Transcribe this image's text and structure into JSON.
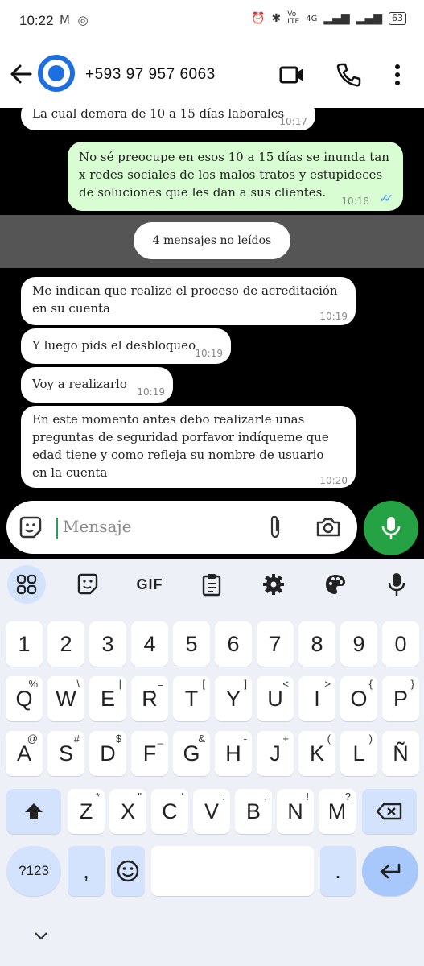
{
  "status_bar": {
    "time": "10:22",
    "battery": "63",
    "network": "4G"
  },
  "header": {
    "contact": "+593 97 957 6063"
  },
  "messages": [
    {
      "direction": "in",
      "text": "La cual demora de 10 a 15 días laborales",
      "time": "10:17"
    },
    {
      "direction": "out",
      "text": "No sé preocupe en esos 10 a 15 días se inunda tan x redes sociales de los malos tratos y estupideces de soluciones que les dan a sus clientes.",
      "time": "10:18",
      "read": true
    },
    {
      "direction": "in",
      "text": "Me indican que realize el proceso de acreditación en su cuenta",
      "time": "10:19"
    },
    {
      "direction": "in",
      "text": "Y luego pids el desbloqueo",
      "time": "10:19"
    },
    {
      "direction": "in",
      "text": "Voy a realizarlo",
      "time": "10:19"
    },
    {
      "direction": "in",
      "text": "En este momento antes debo realizarle unas preguntas de seguridad porfavor indíqueme que edad tiene y como refleja su nombre de usuario en la cuenta",
      "time": "10:20"
    }
  ],
  "unread_label": "4 mensajes no leídos",
  "composer": {
    "placeholder": "Mensaje"
  },
  "keyboard": {
    "toolbar": [
      "apps-icon",
      "sticker-icon",
      "GIF",
      "clipboard-icon",
      "settings-icon",
      "palette-icon",
      "mic-icon"
    ],
    "gif_label": "GIF",
    "row_numbers": [
      "1",
      "2",
      "3",
      "4",
      "5",
      "6",
      "7",
      "8",
      "9",
      "0"
    ],
    "row1": [
      {
        "k": "Q",
        "h": "%"
      },
      {
        "k": "W",
        "h": "\\"
      },
      {
        "k": "E",
        "h": "|"
      },
      {
        "k": "R",
        "h": "="
      },
      {
        "k": "T",
        "h": "["
      },
      {
        "k": "Y",
        "h": "]"
      },
      {
        "k": "U",
        "h": "<"
      },
      {
        "k": "I",
        "h": ">"
      },
      {
        "k": "O",
        "h": "{"
      },
      {
        "k": "P",
        "h": "}"
      }
    ],
    "row2": [
      {
        "k": "A",
        "h": "@"
      },
      {
        "k": "S",
        "h": "#"
      },
      {
        "k": "D",
        "h": "$"
      },
      {
        "k": "F",
        "h": "_"
      },
      {
        "k": "G",
        "h": "&"
      },
      {
        "k": "H",
        "h": "-"
      },
      {
        "k": "J",
        "h": "+"
      },
      {
        "k": "K",
        "h": "("
      },
      {
        "k": "L",
        "h": ")"
      },
      {
        "k": "Ñ",
        "h": ""
      }
    ],
    "row3": [
      {
        "k": "Z",
        "h": "*"
      },
      {
        "k": "X",
        "h": "\""
      },
      {
        "k": "C",
        "h": "'"
      },
      {
        "k": "V",
        "h": ":"
      },
      {
        "k": "B",
        "h": ";"
      },
      {
        "k": "N",
        "h": "!"
      },
      {
        "k": "M",
        "h": "?"
      }
    ],
    "symbols_label": "?123",
    "comma": ",",
    "period": "."
  },
  "colors": {
    "accent": "#25a244",
    "outgoing_bubble": "#d9fdd3",
    "read_ticks": "#3b97e8",
    "keyboard_bg": "#eef0f8"
  }
}
